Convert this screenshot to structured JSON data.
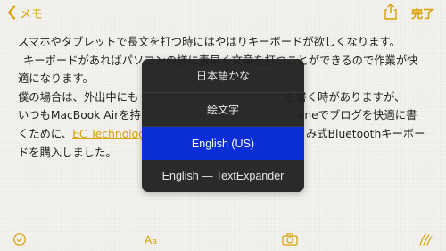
{
  "nav": {
    "back_label": "メモ",
    "done_label": "完了"
  },
  "note": {
    "lines": [
      "スマホやタブレットで長文を打つ時にはやはりキーボードが欲しくなります。",
      "キーボードがあればパソコンの様に素早く文章を打つことができるので作業が快",
      "適になります。",
      "僕の場合は、外出中にも",
      "を書く時がありますが、",
      "いつもMacBook Airを持",
      "oneでブログを快適に書",
      "くために、",
      "EC Technolog",
      "み式Bluetoothキーボー",
      "ドを購入しました。"
    ]
  },
  "popup": {
    "items": [
      {
        "label": "日本語かな",
        "selected": false
      },
      {
        "label": "絵文字",
        "selected": false
      },
      {
        "label": "English (US)",
        "selected": true
      },
      {
        "label": "English — TextExpander",
        "selected": false
      }
    ]
  },
  "colors": {
    "accent": "#d9a200",
    "selected": "#0a2fd6",
    "popup_bg": "#1e1e1e"
  },
  "icons": {
    "back": "chevron-left-icon",
    "share": "share-icon",
    "checklist": "checklist-icon",
    "format": "text-format-icon",
    "camera": "camera-icon",
    "sketch": "sketch-icon"
  }
}
